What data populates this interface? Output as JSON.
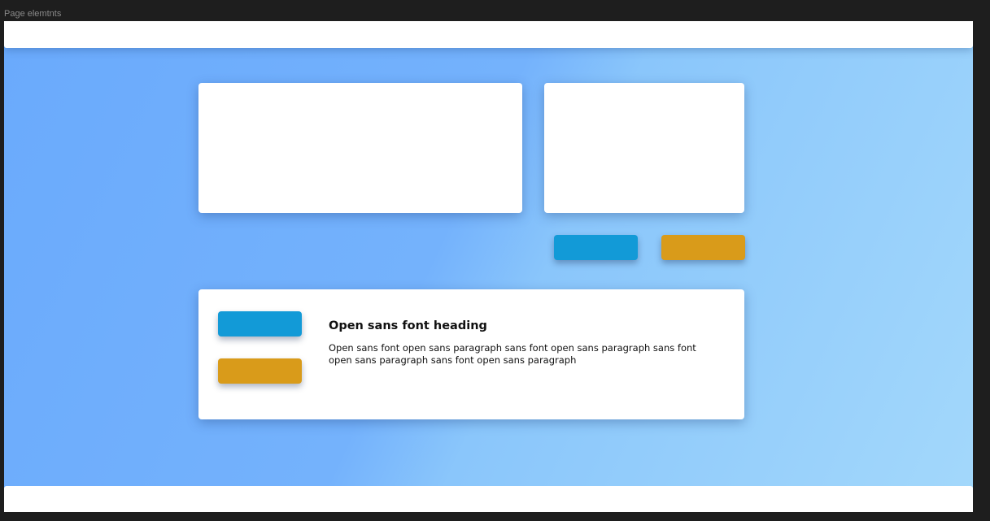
{
  "frame": {
    "label": "Page elemtnts"
  },
  "content_card": {
    "heading": "Open sans font heading",
    "paragraph": "Open sans font open sans paragraph sans font open sans paragraph sans font open sans paragraph sans font open sans paragraph"
  },
  "colors": {
    "primary_button": "#129ad7",
    "secondary_button": "#d99b1a",
    "background_gradient_start": "#6aaafc",
    "background_gradient_end": "#a3d8fb",
    "canvas": "#1e1e1e"
  }
}
